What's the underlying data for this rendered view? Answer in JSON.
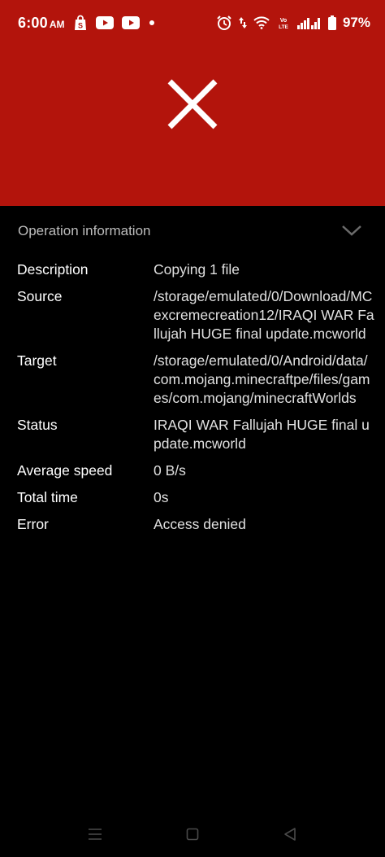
{
  "status_bar": {
    "time": "6:00",
    "time_suffix": "AM",
    "battery": "97%",
    "lte_label": "Vo LTE"
  },
  "header": {
    "background": "#b3140c",
    "close_icon": "close-x-icon"
  },
  "section": {
    "title": "Operation information"
  },
  "info_rows": [
    {
      "label": "Description",
      "value": "Copying 1 file"
    },
    {
      "label": "Source",
      "value": "/storage/emulated/0/Download/MCexcremecreation12/IRAQI WAR Fallujah HUGE final update.mcworld"
    },
    {
      "label": "Target",
      "value": "/storage/emulated/0/Android/data/com.mojang.minecraftpe/files/games/com.mojang/minecraftWorlds"
    },
    {
      "label": "Status",
      "value": "IRAQI WAR Fallujah HUGE final update.mcworld"
    },
    {
      "label": "Average speed",
      "value": "0 B/s"
    },
    {
      "label": "Total time",
      "value": "0s"
    },
    {
      "label": "Error",
      "value": "Access denied"
    }
  ],
  "nav": {
    "recent_icon": "menu-icon",
    "home_icon": "square-icon",
    "back_icon": "triangle-back-icon"
  }
}
